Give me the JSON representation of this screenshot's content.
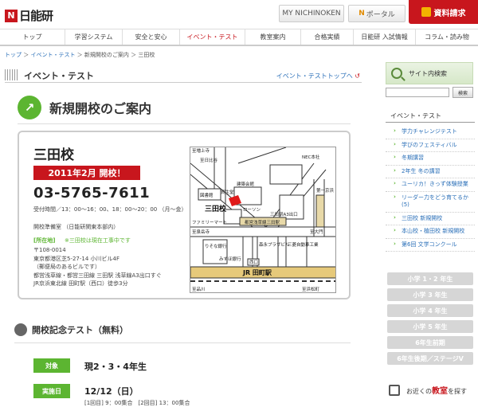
{
  "header": {
    "logo_mark": "N",
    "logo_text": "日能研",
    "my_nichinoken": "MY NICHINOKEN",
    "nportal_icon": "N",
    "nportal": "ポータル",
    "request": "資料請求"
  },
  "gnav": [
    "トップ",
    "学習システム",
    "安全と安心",
    "イベント・テスト",
    "教室案内",
    "合格実績",
    "日能研 入試情報",
    "コラム・読み物"
  ],
  "breadcrumb": {
    "home": "トップ",
    "event": "イベント・テスト",
    "opening": "新規開校のご案内",
    "current": "三田校",
    "sep": " ＞ "
  },
  "section": {
    "title": "イベント・テスト",
    "link": "イベント・テストトップへ"
  },
  "page_title": "新規開校のご案内",
  "school": {
    "name": "三田校",
    "badge": "2011年2月 開校！",
    "phone": "03-5765-7611",
    "hours": "受付時間／13：00〜16：00、18：00〜20：00 （月〜金）",
    "office": "開校準備室 （日能研関東本部内）",
    "addr_label": "[所在地]",
    "addr_note": "※三田校は現在工事中です",
    "postal": "〒108-0014",
    "address": "東京都港区芝5-27-14 小川ビル4F",
    "building_note": "（郵便局のあるビルです）",
    "access1": "都営浅草線・都営三田線 三田駅 浅草線A3出口すぐ",
    "access2": "JR京浜東北線 田町駅（西口）徒歩3分"
  },
  "map": {
    "labels": {
      "zojoji": "至増上寺",
      "hibiya": "至日比谷",
      "library": "図書館",
      "kenchiku": "建築会館",
      "shiseido": "資生堂",
      "nec": "NEC本社",
      "mita": "三田校",
      "lawson": "ローソン",
      "familymart": "ファミリーマート",
      "a3": "三田駅A3出口",
      "sengakuji": "至泉岳寺",
      "daimon": "至大門",
      "ekimae": "都営浅草線三田駅",
      "risona": "りそな銀行",
      "mizuho": "みずほ銀行",
      "morinaga": "森永プラザビル",
      "mitsubishi": "三菱自動車工業",
      "nishiguchi": "西口",
      "tamachi": "JR 田町駅",
      "shinagawa": "至品川",
      "hamamatsucho": "至浜松町",
      "daiichi": "第一京浜"
    }
  },
  "test": {
    "title": "開校記念テスト（無料）",
    "target_label": "対象",
    "target_value": "現2・3・4年生",
    "date_label": "実施日",
    "date_value": "12/12（日）",
    "date_sub": "[1回目] 9：00集合　[2回目] 13：00集合"
  },
  "sidebar": {
    "search_title": "サイト内検索",
    "search_btn": "検索",
    "event_title": "イベント・テスト",
    "items": [
      "学力チャレンジテスト",
      "学びのフェスティバル",
      "冬期講習",
      "2年生 冬の講習",
      "ユーリカ！きっず体験授業",
      "リーダー力をどう育てるか(5)",
      "三田校 新規開校",
      "本山校・植田校 新規開校",
      "第6回 文学コンクール"
    ],
    "grades": [
      "小学 1・2 年生",
      "小学 3 年生",
      "小学 4 年生",
      "小学 5 年生",
      "6年生前期",
      "6年生後期／ステージV"
    ],
    "find_pre": "お近くの",
    "find_em": "教室",
    "find_post": "を探す"
  }
}
